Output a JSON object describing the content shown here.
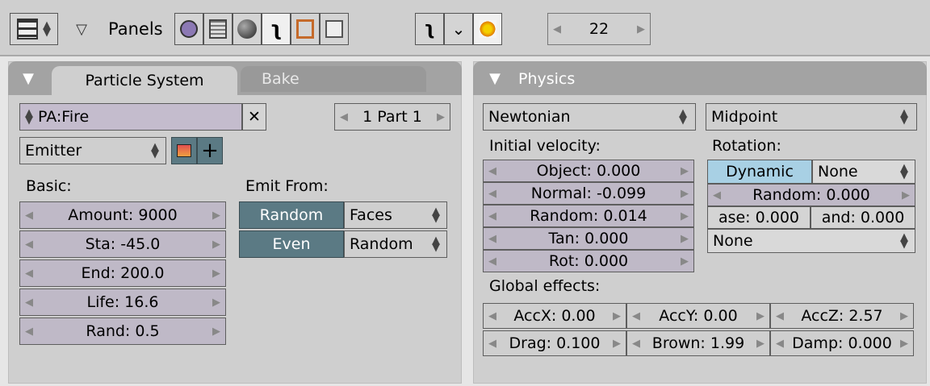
{
  "header": {
    "panels_label": "Panels",
    "frame_value": "22",
    "icons": [
      "shading-context-icon",
      "scene-icon",
      "material-sphere-icon",
      "physics-object-icon",
      "editing-icon",
      "image-icon",
      "particle-icon",
      "constraint-icon",
      "particle-system-icon"
    ]
  },
  "left_panel": {
    "tabs": [
      "Particle System",
      "Bake"
    ],
    "name_field": "PA:Fire",
    "part_selector": "1 Part 1",
    "type_menu": "Emitter",
    "basic_label": "Basic:",
    "basic_fields": [
      "Amount: 9000",
      "Sta: -45.0",
      "End: 200.0",
      "Life: 16.6",
      "Rand: 0.5"
    ],
    "emit_from_label": "Emit From:",
    "emit_toggles": [
      "Random",
      "Even"
    ],
    "emit_menus": [
      "Faces",
      "Random"
    ]
  },
  "right_panel": {
    "title": "Physics",
    "physics_menu": "Newtonian",
    "integrator_menu": "Midpoint",
    "initial_velocity_label": "Initial velocity:",
    "velocity_fields": [
      "Object: 0.000",
      "Normal: -0.099",
      "Random: 0.014",
      "Tan: 0.000",
      "Rot: 0.000"
    ],
    "rotation_label": "Rotation:",
    "dynamic_label": "Dynamic",
    "rotation_mode": "None",
    "rotation_random": "Random: 0.000",
    "phase_fields": [
      "ase: 0.000",
      "and: 0.000"
    ],
    "angular_menu": "None",
    "global_effects_label": "Global effects:",
    "acc_fields": [
      "AccX: 0.00",
      "AccY: 0.00",
      "AccZ: 2.57"
    ],
    "drag_fields": [
      "Drag: 0.100",
      "Brown: 1.99",
      "Damp: 0.000"
    ]
  },
  "colors": {
    "background": "#e6e6e6",
    "panel": "#cfcfcf",
    "panel_header": "#a3a3a3",
    "number_field": "#bfb9c7",
    "toggle_active": "#5b7a84",
    "dynamic_button": "#a8d0e4"
  }
}
